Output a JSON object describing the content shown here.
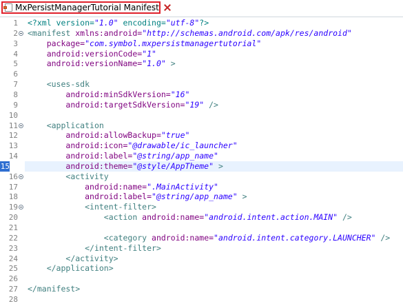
{
  "tab": {
    "title": "MxPersistManagerTutorial Manifest"
  },
  "editor": {
    "highlighted_line": 15,
    "fold_lines": [
      2,
      11,
      16,
      19
    ],
    "lines": [
      [
        [
          "p",
          "<?xml version="
        ],
        [
          "s",
          "\"1.0\""
        ],
        [
          "p",
          " encoding="
        ],
        [
          "s",
          "\"utf-8\""
        ],
        [
          "p",
          "?>"
        ]
      ],
      [
        [
          "t",
          "<manifest "
        ],
        [
          "a",
          "xmlns:android="
        ],
        [
          "s",
          "\"http://schemas.android.com/apk/res/android\""
        ]
      ],
      [
        [
          "g",
          "    "
        ],
        [
          "a",
          "package="
        ],
        [
          "s",
          "\"com.symbol.mxpersistmanagertutorial\""
        ]
      ],
      [
        [
          "g",
          "    "
        ],
        [
          "a",
          "android:versionCode="
        ],
        [
          "s",
          "\"1\""
        ]
      ],
      [
        [
          "g",
          "    "
        ],
        [
          "a",
          "android:versionName="
        ],
        [
          "s",
          "\"1.0\""
        ],
        [
          "t",
          " >"
        ]
      ],
      [],
      [
        [
          "g",
          "    "
        ],
        [
          "t",
          "<uses-sdk"
        ]
      ],
      [
        [
          "g",
          "        "
        ],
        [
          "a",
          "android:minSdkVersion="
        ],
        [
          "s",
          "\"16\""
        ]
      ],
      [
        [
          "g",
          "        "
        ],
        [
          "a",
          "android:targetSdkVersion="
        ],
        [
          "s",
          "\"19\""
        ],
        [
          "t",
          " />"
        ]
      ],
      [],
      [
        [
          "g",
          "    "
        ],
        [
          "t",
          "<application"
        ]
      ],
      [
        [
          "g",
          "        "
        ],
        [
          "a",
          "android:allowBackup="
        ],
        [
          "s",
          "\"true\""
        ]
      ],
      [
        [
          "g",
          "        "
        ],
        [
          "a",
          "android:icon="
        ],
        [
          "s",
          "\"@drawable/ic_launcher\""
        ]
      ],
      [
        [
          "g",
          "        "
        ],
        [
          "a",
          "android:label="
        ],
        [
          "s",
          "\"@string/app_name\""
        ]
      ],
      [
        [
          "g",
          "        "
        ],
        [
          "a",
          "android:theme="
        ],
        [
          "s",
          "\"@style/AppTheme\""
        ],
        [
          "t",
          " >"
        ]
      ],
      [
        [
          "g",
          "        "
        ],
        [
          "t",
          "<activity"
        ]
      ],
      [
        [
          "g",
          "            "
        ],
        [
          "a",
          "android:name="
        ],
        [
          "s",
          "\".MainActivity\""
        ]
      ],
      [
        [
          "g",
          "            "
        ],
        [
          "a",
          "android:label="
        ],
        [
          "s",
          "\"@string/app_name\""
        ],
        [
          "t",
          " >"
        ]
      ],
      [
        [
          "g",
          "            "
        ],
        [
          "t",
          "<intent-filter>"
        ]
      ],
      [
        [
          "g",
          "                "
        ],
        [
          "t",
          "<action "
        ],
        [
          "a",
          "android:name="
        ],
        [
          "s",
          "\"android.intent.action.MAIN\""
        ],
        [
          "t",
          " />"
        ]
      ],
      [],
      [
        [
          "g",
          "                "
        ],
        [
          "t",
          "<category "
        ],
        [
          "a",
          "android:name="
        ],
        [
          "s",
          "\"android.intent.category.LAUNCHER\""
        ],
        [
          "t",
          " />"
        ]
      ],
      [
        [
          "g",
          "            "
        ],
        [
          "t",
          "</intent-filter>"
        ]
      ],
      [
        [
          "g",
          "        "
        ],
        [
          "t",
          "</activity>"
        ]
      ],
      [
        [
          "g",
          "    "
        ],
        [
          "t",
          "</application>"
        ]
      ],
      [],
      [
        [
          "t",
          "</manifest>"
        ]
      ],
      []
    ]
  }
}
